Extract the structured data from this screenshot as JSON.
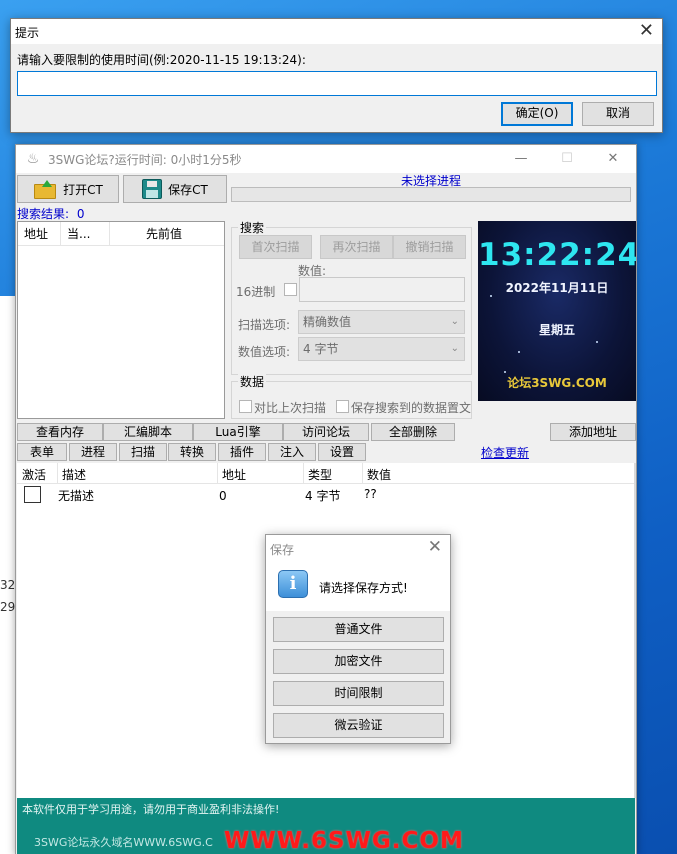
{
  "prompt": {
    "title": "提示",
    "message": "请输入要限制的使用时间(例:2020-11-15 19:13:24):",
    "input_value": "",
    "ok_label": "确定(O)",
    "cancel_label": "取消"
  },
  "main": {
    "title": "3SWG论坛?运行时间: 0小时1分5秒",
    "open_ct_label": "打开CT",
    "save_ct_label": "保存CT",
    "process_label": "未选择进程",
    "results_label": "搜索结果:",
    "results_count": "0",
    "list_headers": [
      "地址",
      "当...",
      "先前值"
    ],
    "search": {
      "group_title": "搜索",
      "first_scan": "首次扫描",
      "next_scan": "再次扫描",
      "undo_scan": "撤销扫描",
      "value_label": "数值:",
      "hex_label": "16进制",
      "scan_option_label": "扫描选项:",
      "scan_option_value": "精确数值",
      "value_option_label": "数值选项:",
      "value_option_value": "4 字节"
    },
    "data_group": {
      "title": "数据",
      "compare_last": "对比上次扫描",
      "save_results": "保存搜索到的数据置文"
    },
    "clock": {
      "time": "13:22:24",
      "date": "2022年11月11日",
      "weekday": "星期五",
      "forum": "论坛3SWG.COM"
    },
    "actions": {
      "view_memory": "查看内存",
      "asm_script": "汇编脚本",
      "lua_engine": "Lua引擎",
      "visit_forum": "访问论坛",
      "delete_all": "全部删除",
      "add_address": "添加地址"
    },
    "tabs": [
      "表单",
      "进程",
      "扫描",
      "转换",
      "插件",
      "注入",
      "设置"
    ],
    "check_update": "检查更新",
    "table_headers": [
      "激活",
      "描述",
      "地址",
      "类型",
      "数值"
    ],
    "rows": [
      {
        "desc": "无描述",
        "address": "0",
        "type": "4 字节",
        "value": "??"
      }
    ],
    "footer_note": "本软件仅用于学习用途，请勿用于商业盈利非法操作!",
    "footer_domain": "3SWG论坛永久域名WWW.6SWG.C",
    "footer_watermark": "WWW.6SWG.COM"
  },
  "save_dialog": {
    "title": "保存",
    "message": "请选择保存方式!",
    "options": [
      "普通文件",
      "加密文件",
      "时间限制",
      "微云验证"
    ]
  },
  "background": {
    "numbers": [
      "32",
      "29"
    ]
  }
}
